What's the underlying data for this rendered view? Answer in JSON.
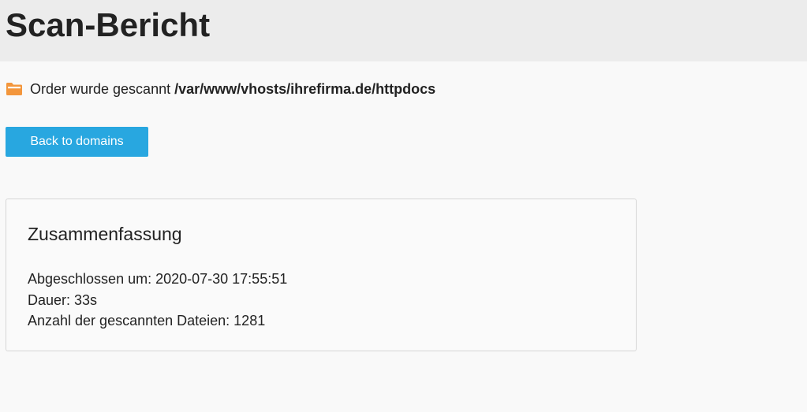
{
  "header": {
    "title": "Scan-Bericht"
  },
  "scan_info": {
    "icon": "folder-icon",
    "text": "Order wurde gescannt",
    "path": "/var/www/vhosts/ihrefirma.de/httpdocs"
  },
  "actions": {
    "back_label": "Back to domains"
  },
  "summary": {
    "title": "Zusammenfassung",
    "completed": "Abgeschlossen um: 2020-07-30 17:55:51",
    "duration": "Dauer: 33s",
    "file_count": "Anzahl der gescannten Dateien: 1281"
  },
  "colors": {
    "accent": "#28a7e0",
    "folder": "#f3963c",
    "header_bg": "#ececec"
  }
}
